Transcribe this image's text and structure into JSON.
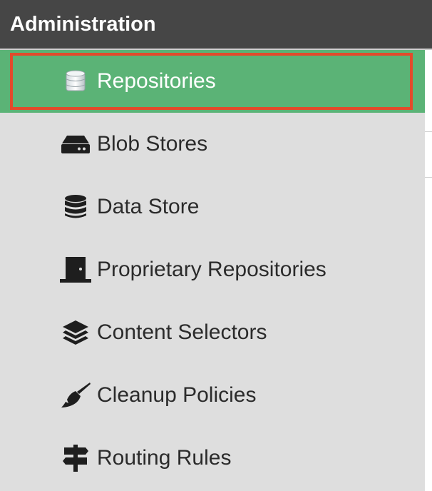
{
  "header": {
    "title": "Administration"
  },
  "colors": {
    "header_bg": "#464646",
    "sidebar_bg": "#dedede",
    "selected_bg": "#5bb376",
    "highlight_border": "#e24b2b"
  },
  "nav": {
    "items": [
      {
        "label": "Repositories",
        "icon": "database-stack-icon",
        "selected": true
      },
      {
        "label": "Blob Stores",
        "icon": "hard-drive-icon",
        "selected": false
      },
      {
        "label": "Data Store",
        "icon": "database-icon",
        "selected": false
      },
      {
        "label": "Proprietary Repositories",
        "icon": "door-icon",
        "selected": false
      },
      {
        "label": "Content Selectors",
        "icon": "layers-icon",
        "selected": false
      },
      {
        "label": "Cleanup Policies",
        "icon": "broom-icon",
        "selected": false
      },
      {
        "label": "Routing Rules",
        "icon": "signpost-icon",
        "selected": false
      }
    ]
  }
}
